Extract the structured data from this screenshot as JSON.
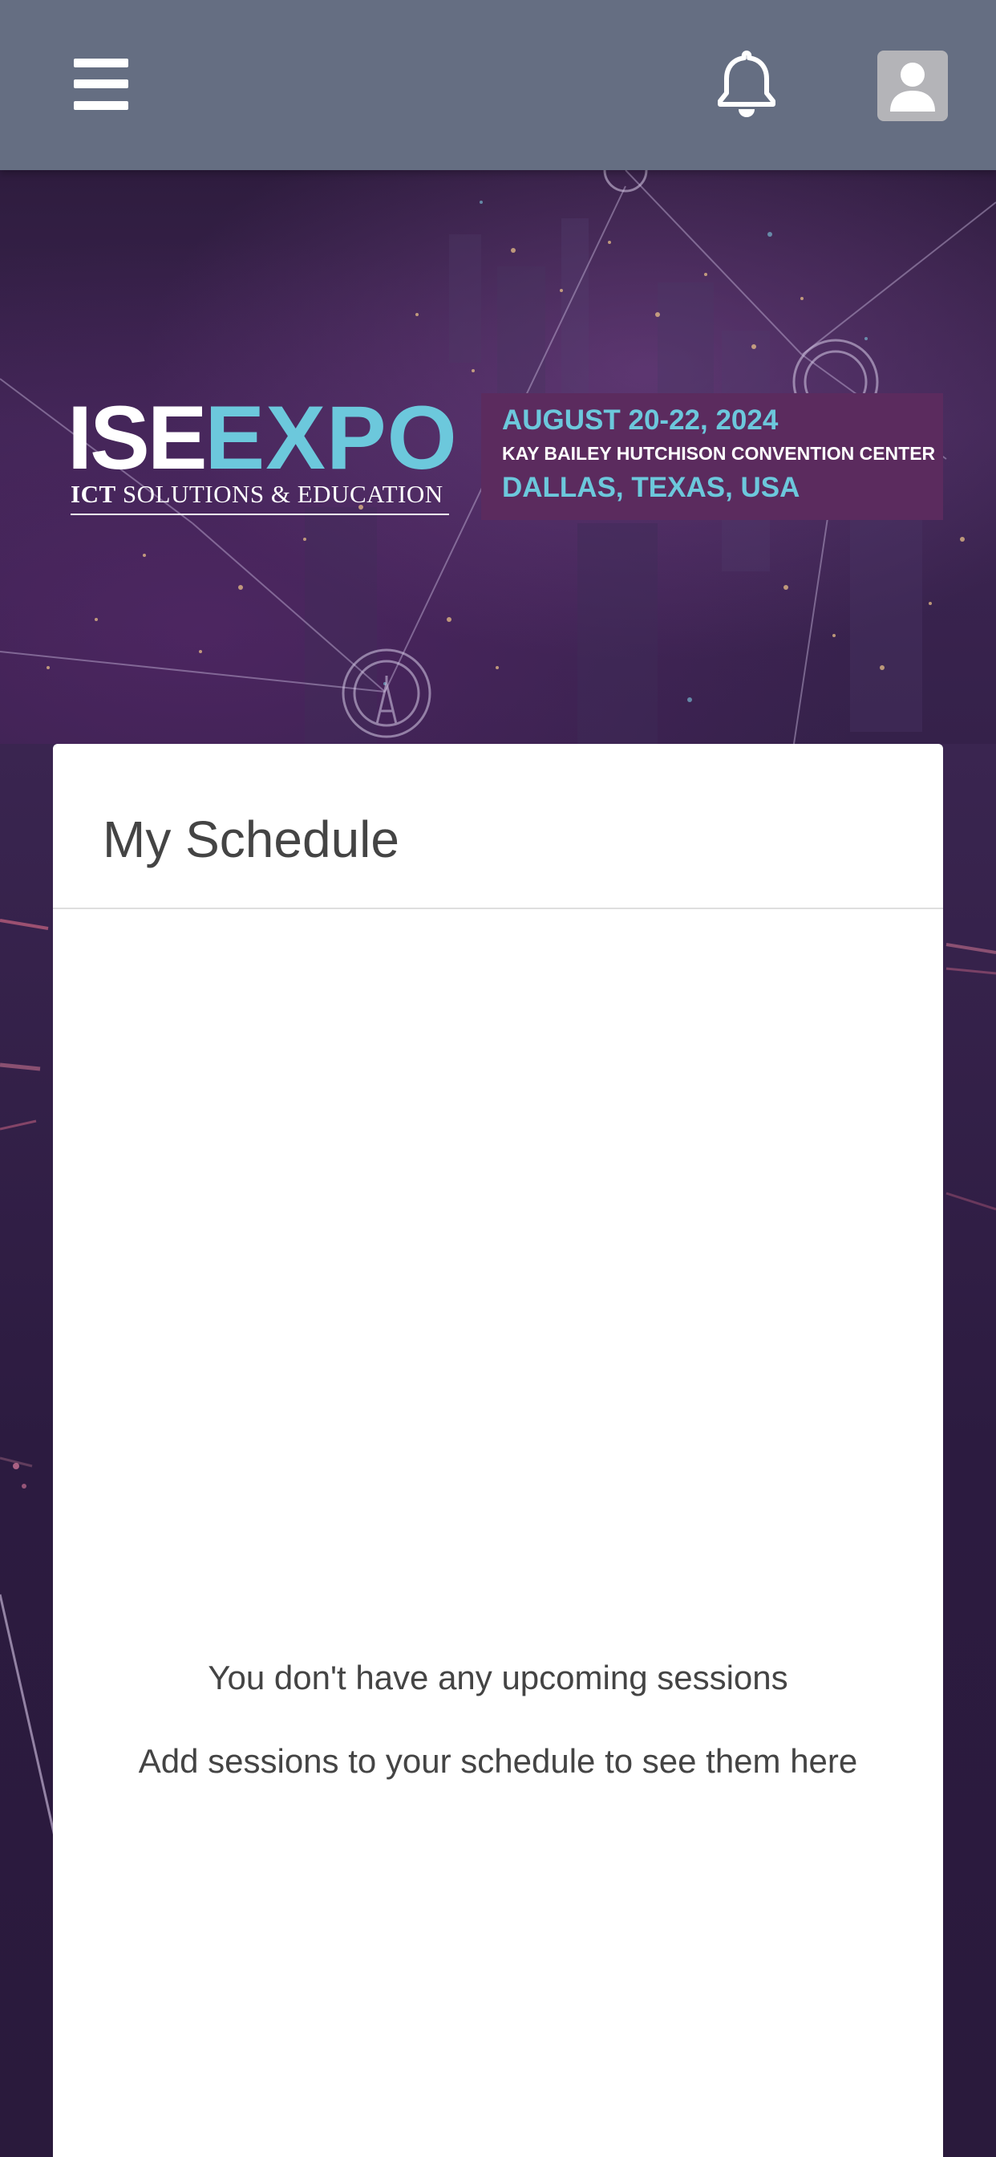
{
  "header": {
    "menu_icon": "hamburger-menu-icon",
    "notifications_icon": "bell-icon",
    "profile_icon": "user-avatar-icon",
    "background_color": "#656e82"
  },
  "banner": {
    "logo_ise": "ISE",
    "logo_expo": "EXPO",
    "logo_tagline_prefix": "ICT",
    "logo_tagline_rest": "SOLUTIONS & EDUCATION",
    "dates": "AUGUST 20-22, 2024",
    "venue": "KAY BAILEY HUTCHISON CONVENTION CENTER",
    "location": "DALLAS, TEXAS, USA",
    "accent_color": "#6cc8dc",
    "box_color": "#5b2b5e"
  },
  "schedule": {
    "title": "My Schedule",
    "empty_title": "You don't have any upcoming sessions",
    "empty_subtitle": "Add sessions to your schedule to see them here"
  }
}
